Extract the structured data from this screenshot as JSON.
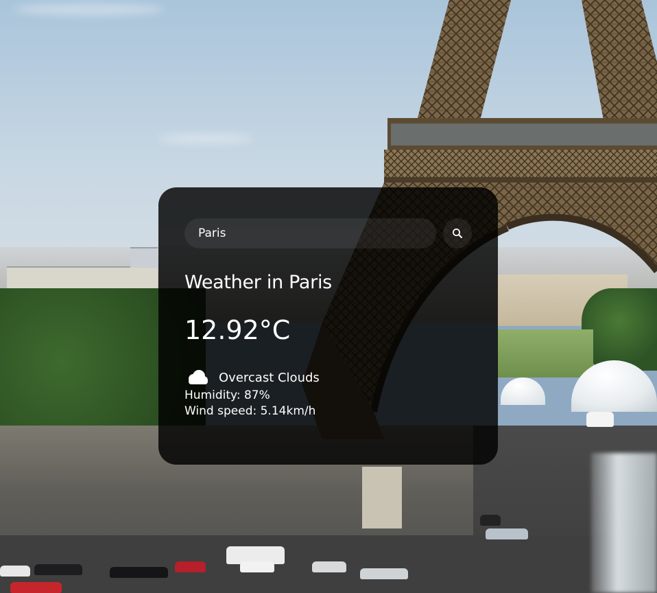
{
  "search": {
    "value": "Paris",
    "placeholder": "Search",
    "button_icon": "search-icon"
  },
  "weather": {
    "title": "Weather in Paris",
    "temperature": "12.92°C",
    "condition_icon": "cloud-icon",
    "description": "Overcast Clouds",
    "humidity": "Humidity: 87%",
    "wind": "Wind speed: 5.14km/h"
  },
  "background": {
    "subject": "Eiffel Tower, Paris",
    "card_color": "#000000",
    "text_color": "#ffffff"
  }
}
